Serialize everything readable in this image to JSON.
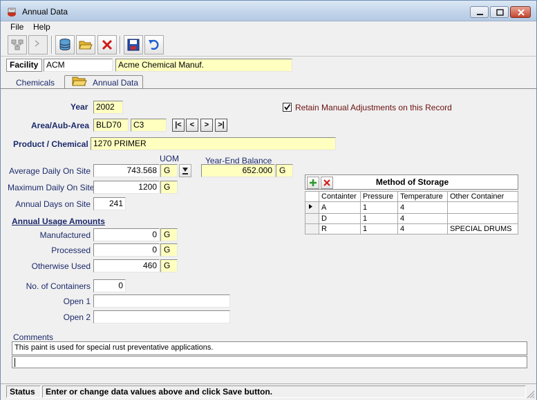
{
  "window": {
    "title": "Annual Data"
  },
  "menu": {
    "file": "File",
    "help": "Help"
  },
  "facility": {
    "label": "Facility",
    "code": "ACM",
    "name": "Acme Chemical Manuf."
  },
  "tabs": [
    {
      "label": "Chemicals"
    },
    {
      "label": "Annual Data"
    }
  ],
  "form": {
    "year_label": "Year",
    "year": "2002",
    "retain_label": "Retain Manual Adjustments on this Record",
    "retain_checked": true,
    "area_label": "Area/Aub-Area",
    "area": "BLD70",
    "sub_area": "C3",
    "nav": {
      "first": "|<",
      "prev": "<",
      "next": ">",
      "last": ">|"
    },
    "product_label": "Product / Chemical",
    "product": "1270 PRIMER",
    "uom_label": "UOM",
    "year_end_label": "Year-End Balance",
    "avg_daily_label": "Average Daily On Site",
    "avg_daily": "743.568",
    "avg_daily_unit": "G",
    "year_end_value": "652.000",
    "year_end_unit": "G",
    "max_daily_label": "Maximum Daily On Site",
    "max_daily": "1200",
    "max_daily_unit": "G",
    "annual_days_label": "Annual Days on Site",
    "annual_days": "241",
    "usage_header": "Annual Usage Amounts",
    "manufactured_label": "Manufactured",
    "manufactured": "0",
    "manufactured_unit": "G",
    "processed_label": "Processed",
    "processed": "0",
    "processed_unit": "G",
    "otherwise_label": "Otherwise Used",
    "otherwise": "460",
    "otherwise_unit": "G",
    "containers_label": "No. of Containers",
    "containers": "0",
    "open1_label": "Open 1",
    "open1": "",
    "open2_label": "Open 2",
    "open2": "",
    "comments_label": "Comments",
    "comments": "This paint is used for special rust preventative applications."
  },
  "storage": {
    "title": "Method of Storage",
    "columns": [
      "Containter",
      "Pressure",
      "Temperature",
      "Other Container"
    ],
    "rows": [
      [
        "A",
        "1",
        "4",
        ""
      ],
      [
        "D",
        "1",
        "4",
        ""
      ],
      [
        "R",
        "1",
        "4",
        "SPECIAL DRUMS"
      ]
    ]
  },
  "status": {
    "label": "Status",
    "message": "Enter or change data values above and click Save button."
  },
  "icons": [
    "app-icon",
    "network-icon",
    "arrow-icon",
    "database-icon",
    "open-folder-icon",
    "delete-icon",
    "save-icon",
    "undo-icon",
    "add-icon",
    "remove-icon",
    "row-pointer-icon",
    "lookup-icon",
    "folder-tab-icon"
  ]
}
